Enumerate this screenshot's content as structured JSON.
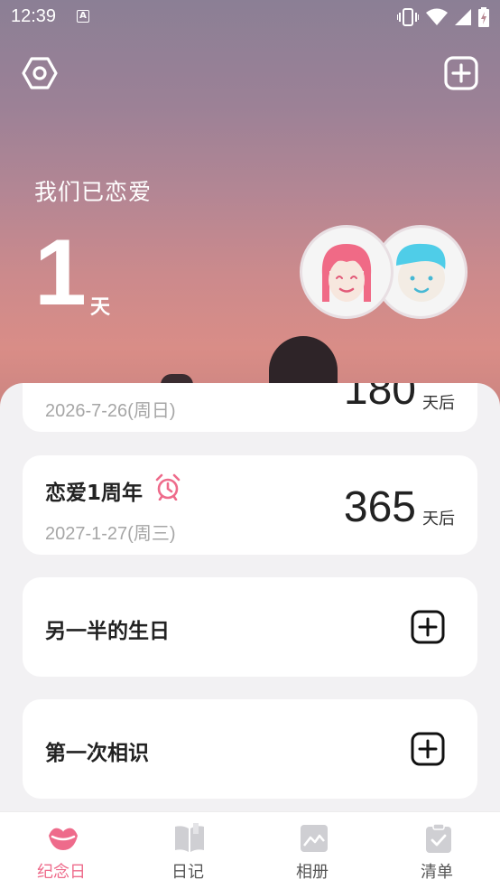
{
  "status_bar": {
    "time": "12:39",
    "notification_letter": "A"
  },
  "hero": {
    "subtitle": "我们已恋爱",
    "days": "1",
    "days_unit": "天"
  },
  "icons": {
    "settings": "hexagon-gear-icon",
    "add": "plus-square-icon",
    "girl_avatar": "girl-avatar",
    "boy_avatar": "boy-avatar"
  },
  "cards": {
    "partial": {
      "date": "2026-7-26(周日)",
      "count": "180",
      "unit": "天后"
    },
    "anniversary": {
      "title": "恋爱1周年",
      "date": "2027-1-27(周三)",
      "count": "365",
      "unit": "天后"
    },
    "birthday": {
      "title": "另一半的生日"
    },
    "first_meet": {
      "title": "第一次相识"
    }
  },
  "tabs": [
    {
      "label": "纪念日",
      "icon": "lips-icon",
      "active": true
    },
    {
      "label": "日记",
      "icon": "book-icon",
      "active": false
    },
    {
      "label": "相册",
      "icon": "photo-icon",
      "active": false
    },
    {
      "label": "清单",
      "icon": "checklist-icon",
      "active": false
    }
  ],
  "colors": {
    "accent": "#ee6b8b",
    "inactive_icon": "#cfcfd3"
  }
}
